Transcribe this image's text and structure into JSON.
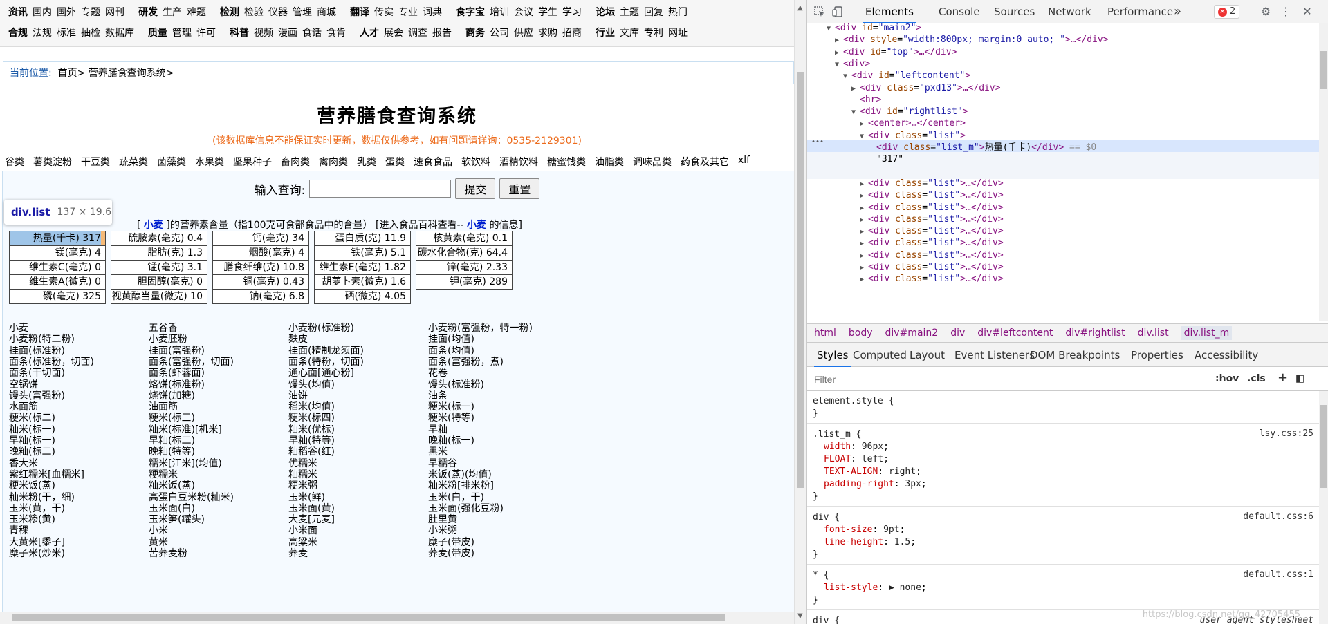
{
  "nav": {
    "row1": [
      [
        "资讯",
        "国内",
        "国外",
        "专题",
        "网刊"
      ],
      [
        "研发",
        "生产",
        "难题"
      ],
      [
        "检测",
        "检验",
        "仪器",
        "管理",
        "商城"
      ],
      [
        "翻译",
        "传实",
        "专业",
        "词典"
      ],
      [
        "食字宝",
        "培训",
        "会议",
        "学生",
        "学习"
      ],
      [
        "论坛",
        "主题",
        "回复",
        "热门"
      ]
    ],
    "row2": [
      [
        "合规",
        "法规",
        "标准",
        "抽检",
        "数据库"
      ],
      [
        "质量",
        "管理",
        "许可"
      ],
      [
        "科普",
        "视频",
        "漫画",
        "食话",
        "食肯"
      ],
      [
        "人才",
        "展会",
        "调查",
        "报告"
      ],
      [
        "商务",
        "公司",
        "供应",
        "求购",
        "招商"
      ],
      [
        "行业",
        "文库",
        "专利",
        "网址"
      ]
    ]
  },
  "breadcrumb": {
    "label": "当前位置:",
    "home": "首页>",
    "current": "营养膳食查询系统>"
  },
  "title": "营养膳食查询系统",
  "notice": "(该数据库信息不能保证实时更新，数据仅供参考，如有问题请详询：0535-2129301)",
  "categories": [
    "谷类",
    "薯类淀粉",
    "干豆类",
    "蔬菜类",
    "菌藻类",
    "水果类",
    "坚果种子",
    "畜肉类",
    "禽肉类",
    "乳类",
    "蛋类",
    "速食食品",
    "软饮料",
    "酒精饮料",
    "糖蜜饯类",
    "油脂类",
    "调味品类",
    "药食及其它",
    "xlf"
  ],
  "search": {
    "label": "输入查询:",
    "value": "",
    "submit": "提交",
    "reset": "重置"
  },
  "tooltip": {
    "name": "div.list",
    "size": "137 × 19.6"
  },
  "nutrition": {
    "head_pre": "[ ",
    "keyword": "小麦",
    "head_mid": " ]的营养素含量（指100克可食部食品中的含量）   [进入食品百科查看-- ",
    "keyword2": "小麦",
    "head_post": " 的信息]",
    "items": [
      "热量(千卡) 317",
      "硫胺素(毫克) 0.4",
      "钙(毫克) 34",
      "蛋白质(克) 11.9",
      "核黄素(毫克) 0.1",
      "镁(毫克) 4",
      "脂肪(克) 1.3",
      "烟酸(毫克) 4",
      "铁(毫克) 5.1",
      "碳水化合物(克) 64.4",
      "维生素C(毫克) 0",
      "锰(毫克) 3.1",
      "膳食纤维(克) 10.8",
      "维生素E(毫克) 1.82",
      "锌(毫克) 2.33",
      "维生素A(微克) 0",
      "胆固醇(毫克) 0",
      "铜(毫克) 0.43",
      "胡萝卜素(微克) 1.6",
      "钾(毫克) 289",
      "磷(毫克) 325",
      "视黄醇当量(微克) 10",
      "钠(毫克) 6.8",
      "硒(微克) 4.05"
    ]
  },
  "foods": [
    "小麦",
    "五谷香",
    "小麦粉(标准粉)",
    "小麦粉(富强粉，特一粉)",
    "小麦粉(特二粉)",
    "小麦胚粉",
    "麸皮",
    "挂面(均值)",
    "挂面(标准粉)",
    "挂面(富强粉)",
    "挂面(精制龙须面)",
    "面条(均值)",
    "面条(标准粉，切面)",
    "面条(富强粉，切面)",
    "面条(特粉，切面)",
    "面条(富强粉，煮)",
    "面条(干切面)",
    "面条(虾蓉面)",
    "通心面[通心粉]",
    "花卷",
    "空锅饼",
    "烙饼(标准粉)",
    "馒头(均值)",
    "馒头(标准粉)",
    "馒头(富强粉)",
    "烧饼(加糖)",
    "油饼",
    "油条",
    "水面筋",
    "油面筋",
    "稻米(均值)",
    "粳米(标一)",
    "粳米(标二)",
    "粳米(标三)",
    "粳米(标四)",
    "粳米(特等)",
    "籼米(标一)",
    "籼米(标准)[机米]",
    "籼米(优标)",
    "早籼",
    "早籼(标一)",
    "早籼(标二)",
    "早籼(特等)",
    "晚籼(标一)",
    "晚籼(标二)",
    "晚籼(特等)",
    "籼稻谷(红)",
    "黑米",
    "香大米",
    "糯米[江米](均值)",
    "优糯米",
    "早糯谷",
    "紫红糯米[血糯米]",
    "粳糯米",
    "籼糯米",
    "米饭(蒸)(均值)",
    "粳米饭(蒸)",
    "籼米饭(蒸)",
    "粳米粥",
    "籼米粉[排米粉]",
    "籼米粉(干，细)",
    "高蛋白豆米粉(籼米)",
    "玉米(鲜)",
    "玉米(白，干)",
    "玉米(黄，干)",
    "玉米面(白)",
    "玉米面(黄)",
    "玉米面(强化豆粉)",
    "玉米糁(黄)",
    "玉米笋(罐头)",
    "大麦[元麦]",
    "肚里黄",
    "青稞",
    "小米",
    "小米面",
    "小米粥",
    "大黄米[黍子]",
    "黄米",
    "高粱米",
    "糜子(带皮)",
    "糜子米(炒米)",
    "苦荞麦粉",
    "荞麦",
    "荞麦(带皮)"
  ],
  "devtools": {
    "tabs": [
      "Elements",
      "Console",
      "Sources",
      "Network",
      "Performance"
    ],
    "more": "»",
    "errors": "2",
    "dom_lines": [
      {
        "t": "open",
        "tag": "div",
        "attrs": [
          [
            "id",
            "main2"
          ]
        ],
        "tail": ">"
      },
      {
        "t": "collapsed",
        "tag": "div",
        "attrs": [
          [
            "style",
            "width:800px; margin:0 auto; "
          ]
        ],
        "tail": ">…</div>"
      },
      {
        "t": "collapsed",
        "tag": "div",
        "attrs": [
          [
            "id",
            "top"
          ]
        ],
        "tail": ">…</div>"
      },
      {
        "t": "open",
        "tag": "div",
        "attrs": [],
        "tail": ">"
      },
      {
        "t": "open",
        "tag": "div",
        "attrs": [
          [
            "id",
            "leftcontent"
          ]
        ],
        "tail": ">"
      },
      {
        "t": "collapsed",
        "tag": "div",
        "attrs": [
          [
            "class",
            "pxd13"
          ]
        ],
        "tail": ">…</div>"
      },
      {
        "t": "leaf",
        "tag": "hr",
        "attrs": [],
        "tail": ">"
      },
      {
        "t": "open",
        "tag": "div",
        "attrs": [
          [
            "id",
            "rightlist"
          ]
        ],
        "tail": ">"
      },
      {
        "t": "collapsed",
        "tag": "center",
        "attrs": [],
        "tail": ">…</center>"
      },
      {
        "t": "open",
        "tag": "div",
        "attrs": [
          [
            "class",
            "list"
          ]
        ],
        "tail": ">"
      },
      {
        "t": "selected",
        "tag": "div",
        "attrs": [
          [
            "class",
            "list_m"
          ]
        ],
        "text": "热量(千卡)",
        "close": "</div>",
        "eq": " == $0"
      },
      {
        "t": "text",
        "text": "\"317\""
      },
      {
        "t": "close",
        "text": "</div>"
      },
      {
        "t": "collapsed",
        "tag": "div",
        "attrs": [
          [
            "class",
            "list"
          ]
        ],
        "tail": ">…</div>"
      },
      {
        "t": "collapsed",
        "tag": "div",
        "attrs": [
          [
            "class",
            "list"
          ]
        ],
        "tail": ">…</div>"
      },
      {
        "t": "collapsed",
        "tag": "div",
        "attrs": [
          [
            "class",
            "list"
          ]
        ],
        "tail": ">…</div>"
      },
      {
        "t": "collapsed",
        "tag": "div",
        "attrs": [
          [
            "class",
            "list"
          ]
        ],
        "tail": ">…</div>"
      },
      {
        "t": "collapsed",
        "tag": "div",
        "attrs": [
          [
            "class",
            "list"
          ]
        ],
        "tail": ">…</div>"
      },
      {
        "t": "collapsed",
        "tag": "div",
        "attrs": [
          [
            "class",
            "list"
          ]
        ],
        "tail": ">…</div>"
      },
      {
        "t": "collapsed",
        "tag": "div",
        "attrs": [
          [
            "class",
            "list"
          ]
        ],
        "tail": ">…</div>"
      },
      {
        "t": "collapsed",
        "tag": "div",
        "attrs": [
          [
            "class",
            "list"
          ]
        ],
        "tail": ">…</div>"
      },
      {
        "t": "collapsed",
        "tag": "div",
        "attrs": [
          [
            "class",
            "list"
          ]
        ],
        "tail": ">…</div>"
      }
    ],
    "crumbs": [
      "html",
      "body",
      "div#main2",
      "div",
      "div#leftcontent",
      "div#rightlist",
      "div.list",
      "div.list_m"
    ],
    "subtabs": [
      "Styles",
      "Computed",
      "Layout",
      "Event Listeners",
      "DOM Breakpoints",
      "Properties",
      "Accessibility"
    ],
    "filter_placeholder": "Filter",
    "filter_hov": ":hov",
    "filter_cls": ".cls",
    "rules": [
      {
        "selector": "element.style {",
        "src": "",
        "props": []
      },
      {
        "selector": ".list_m {",
        "src": "lsy.css:25",
        "props": [
          [
            "width",
            "96px"
          ],
          [
            "FLOAT",
            "left"
          ],
          [
            "TEXT-ALIGN",
            "right"
          ],
          [
            "padding-right",
            "3px"
          ]
        ]
      },
      {
        "selector": "div {",
        "src": "default.css:6",
        "props": [
          [
            "font-size",
            "9pt"
          ],
          [
            "line-height",
            "1.5"
          ]
        ]
      },
      {
        "selector": "* {",
        "src": "default.css:1",
        "props": [
          [
            "list-style",
            "▶ none"
          ]
        ]
      },
      {
        "selector": "div {",
        "src": "user agent stylesheet",
        "props": []
      }
    ],
    "watermark": "https://blog.csdn.net/qq_42705455"
  }
}
